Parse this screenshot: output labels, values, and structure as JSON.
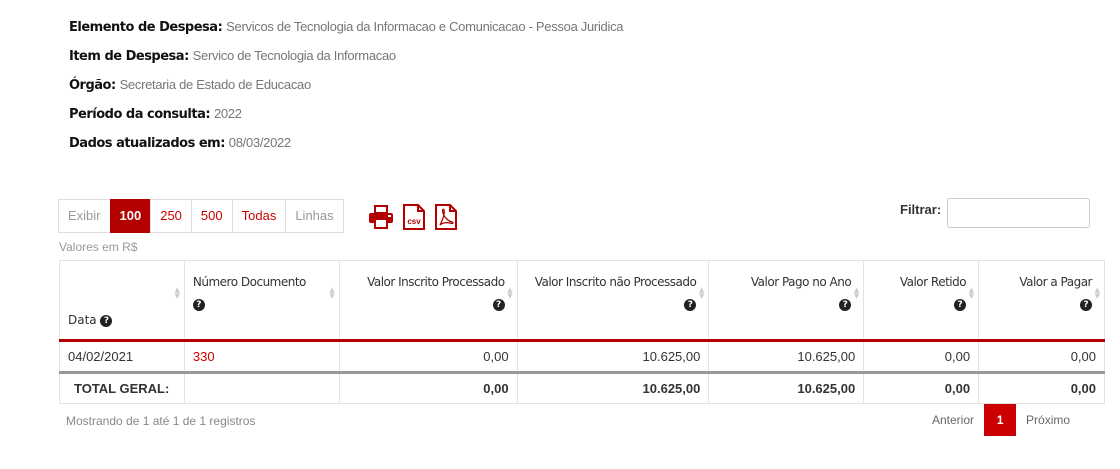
{
  "info": [
    {
      "label": "Elemento de Despesa:",
      "value": "Servicos de Tecnologia da Informacao e Comunicacao - Pessoa Juridica"
    },
    {
      "label": "Item de Despesa:",
      "value": "Servico de Tecnologia da Informacao"
    },
    {
      "label": "Órgão:",
      "value": "Secretaria de Estado de Educacao"
    },
    {
      "label": "Período da consulta:",
      "value": "2022"
    },
    {
      "label": "Dados atualizados em:",
      "value": "08/03/2022"
    }
  ],
  "controls": {
    "exibir": "Exibir",
    "opt100": "100",
    "opt250": "250",
    "opt500": "500",
    "todas": "Todas",
    "linhas": "Linhas",
    "filtrar": "Filtrar:",
    "valores": "Valores em R$",
    "csv": "csv"
  },
  "table": {
    "headers": [
      "Data",
      "Número Documento",
      "Valor Inscrito Processado",
      "Valor Inscrito não Processado",
      "Valor Pago no Ano",
      "Valor Retido",
      "Valor a Pagar"
    ],
    "row": [
      "04/02/2021",
      "330",
      "0,00",
      "10.625,00",
      "10.625,00",
      "0,00",
      "0,00"
    ],
    "total": [
      "TOTAL GERAL:",
      "",
      "0,00",
      "10.625,00",
      "10.625,00",
      "0,00",
      "0,00"
    ]
  },
  "footer": {
    "mostrando": "Mostrando de 1 até 1 de 1 registros",
    "anterior": "Anterior",
    "page": "1",
    "proximo": "Próximo"
  },
  "colors": {
    "accent": "#b30000",
    "link": "#cc0000"
  }
}
